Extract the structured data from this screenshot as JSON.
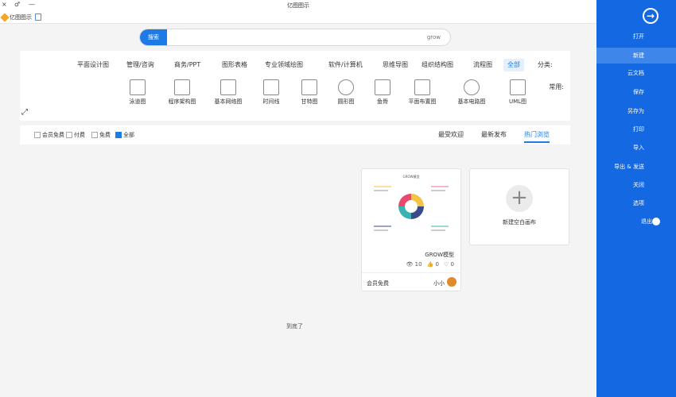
{
  "window": {
    "title": "亿图图示",
    "close_glyph": "×",
    "minimize_glyph": "—",
    "restore_glyph": "♂"
  },
  "tab": {
    "label": "亿图图示"
  },
  "search": {
    "button_label": "搜索",
    "placeholder": "grow"
  },
  "categories": {
    "label": "分类:",
    "items": [
      "全部",
      "流程图",
      "组织结构图",
      "思维导图",
      "软件/计算机",
      "专业领域绘图",
      "图形表格",
      "商务/PPT",
      "管理/咨询",
      "平面设计图"
    ]
  },
  "common": {
    "label": "常用:",
    "templates": [
      "UML图",
      "基本电路图",
      "平面布置图",
      "鱼骨",
      "圆形图",
      "甘特图",
      "时间线",
      "基本网络图",
      "程序架构图",
      "泳道图"
    ]
  },
  "filters": {
    "tabs": [
      "热门浏览",
      "最新发布",
      "最受欢迎"
    ],
    "checks": [
      "全部",
      "免费",
      "付费",
      "会员免费"
    ]
  },
  "new_card": {
    "label": "新建空白画布"
  },
  "template_card": {
    "name": "GROW模型",
    "thumb_title": "GROW模型",
    "views": "10",
    "likes": "0",
    "favorites": "0",
    "price_tag": "会员免费",
    "author": "小小"
  },
  "bottom_text": "到底了",
  "sidebar": {
    "back_glyph": "→",
    "items": [
      "打开",
      "新建",
      "云文档",
      "保存",
      "另存为",
      "打印",
      "导入",
      "导出 & 发送",
      "关闭",
      "选项",
      "退出"
    ],
    "active": "新建"
  },
  "colors": {
    "accent": "#1e7be6",
    "sidebar": "#1469e3",
    "sidebar_active": "#3f86ea"
  }
}
